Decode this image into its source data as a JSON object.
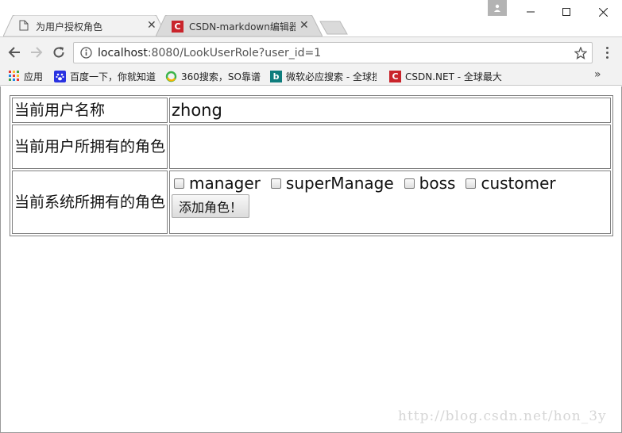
{
  "browser": {
    "tabs": [
      {
        "title": "为用户授权角色",
        "active": true
      },
      {
        "title": "CSDN-markdown编辑器",
        "active": false
      }
    ],
    "address": {
      "host": "localhost",
      "rest": ":8080/LookUserRole?user_id=1"
    },
    "bookmarks": [
      {
        "label": "应用",
        "icon": "apps-grid-icon"
      },
      {
        "label": "百度一下，你就知道",
        "icon": "baidu-paw-icon"
      },
      {
        "label": "360搜索，SO靠谱",
        "icon": "360-search-icon"
      },
      {
        "label": "微软必应搜索 - 全球搜",
        "icon": "bing-icon"
      },
      {
        "label": "CSDN.NET - 全球最大",
        "icon": "csdn-icon"
      }
    ],
    "colors": {
      "csdn_red": "#c9242b",
      "bing_teal": "#0f7d7d",
      "baidu_blue": "#2932e1"
    }
  },
  "page": {
    "rows": {
      "user_name_label": "当前用户名称",
      "user_name_value": "zhong",
      "user_roles_label": "当前用户所拥有的角色",
      "system_roles_label": "当前系统所拥有的角色"
    },
    "roles": [
      {
        "label": "manager",
        "checked": false
      },
      {
        "label": "superManage",
        "checked": false
      },
      {
        "label": "boss",
        "checked": false
      },
      {
        "label": "customer",
        "checked": false
      }
    ],
    "add_button": "添加角色！",
    "watermark": "http://blog.csdn.net/hon_3y"
  }
}
